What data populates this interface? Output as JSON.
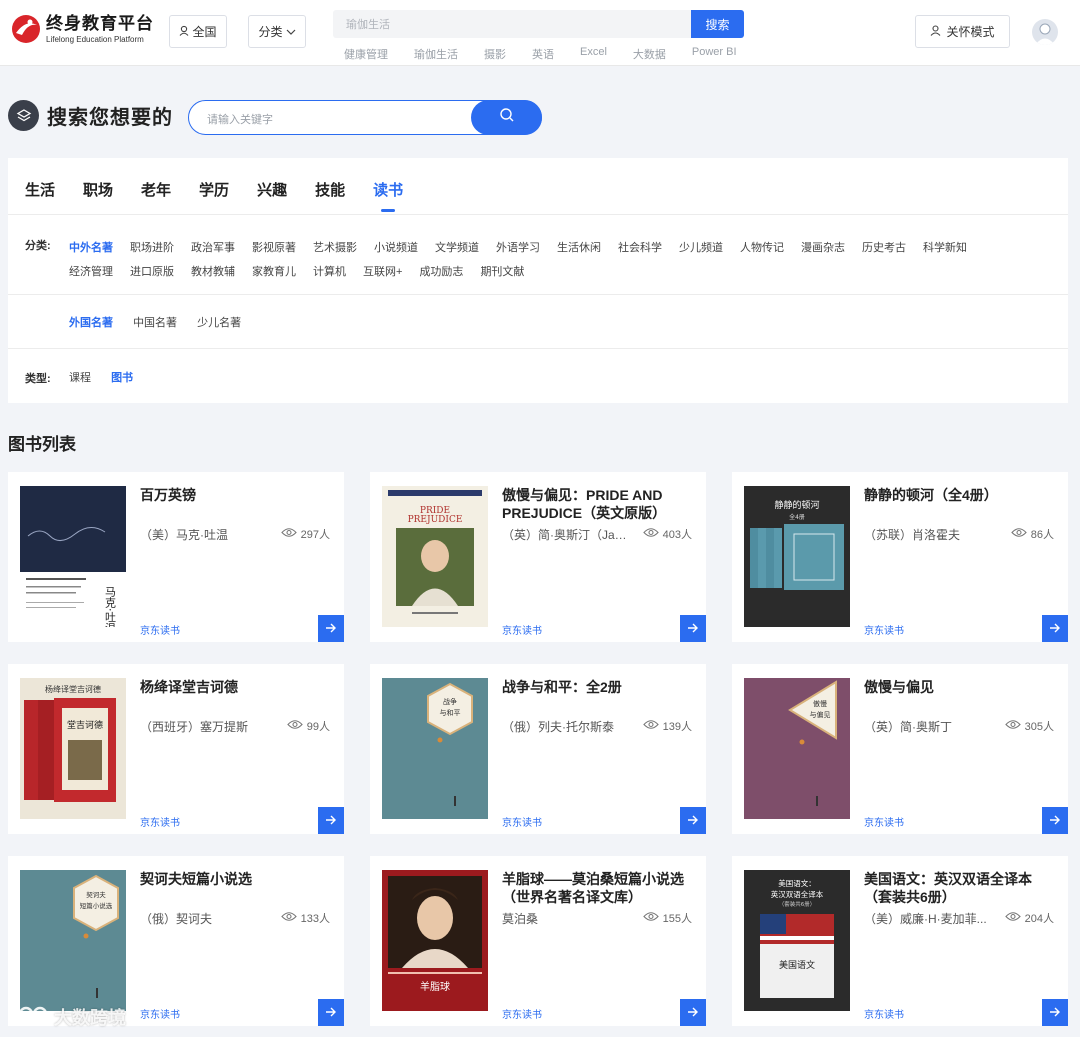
{
  "header": {
    "logo_cn": "终身教育平台",
    "logo_en": "Lifelong Education Platform",
    "region_label": "全国",
    "category_label": "分类",
    "search_placeholder": "瑜伽生活",
    "search_button": "搜索",
    "hot_keywords": [
      "健康管理",
      "瑜伽生活",
      "摄影",
      "英语",
      "Excel",
      "大数据",
      "Power BI"
    ],
    "care_mode_label": "关怀模式"
  },
  "search": {
    "title": "搜索您想要的",
    "placeholder": "请输入关键字"
  },
  "tabs": [
    "生活",
    "职场",
    "老年",
    "学历",
    "兴趣",
    "技能",
    "读书"
  ],
  "active_tab": "读书",
  "filters": {
    "category_label": "分类:",
    "categories": [
      "中外名著",
      "职场进阶",
      "政治军事",
      "影视原著",
      "艺术摄影",
      "小说频道",
      "文学频道",
      "外语学习",
      "生活休闲",
      "社会科学",
      "少儿频道",
      "人物传记",
      "漫画杂志",
      "历史考古",
      "科学新知",
      "经济管理",
      "进口原版",
      "教材教辅",
      "家教育儿",
      "计算机",
      "互联网+",
      "成功励志",
      "期刊文献"
    ],
    "subcategories": [
      "外国名著",
      "中国名著",
      "少儿名著"
    ],
    "type_label": "类型:",
    "types": [
      "课程",
      "图书"
    ]
  },
  "list_title": "图书列表",
  "books": [
    {
      "title": "百万英镑",
      "author": "（美）马克·吐温",
      "views": "297人",
      "source": "京东读书",
      "cover": "twain"
    },
    {
      "title": "傲慢与偏见：PRIDE AND PREJUDICE（英文原版）",
      "author": "（英）简·奥斯汀（Jan...",
      "views": "403人",
      "source": "京东读书",
      "cover": "pride"
    },
    {
      "title": "静静的顿河（全4册）",
      "author": "（苏联）肖洛霍夫",
      "views": "86人",
      "source": "京东读书",
      "cover": "don"
    },
    {
      "title": "杨绛译堂吉诃德",
      "author": "（西班牙）塞万提斯",
      "views": "99人",
      "source": "京东读书",
      "cover": "quixote"
    },
    {
      "title": "战争与和平：全2册",
      "author": "（俄）列夫·托尔斯泰",
      "views": "139人",
      "source": "京东读书",
      "cover": "war"
    },
    {
      "title": "傲慢与偏见",
      "author": "（英）简·奥斯丁",
      "views": "305人",
      "source": "京东读书",
      "cover": "pride2"
    },
    {
      "title": "契诃夫短篇小说选",
      "author": "（俄）契诃夫",
      "views": "133人",
      "source": "京东读书",
      "cover": "chekhov"
    },
    {
      "title": "羊脂球——莫泊桑短篇小说选（世界名著名译文库）",
      "author": "莫泊桑",
      "views": "155人",
      "source": "京东读书",
      "cover": "boule"
    },
    {
      "title": "美国语文：英汉双语全译本（套装共6册）",
      "author": "（美）威廉·H·麦加菲...",
      "views": "204人",
      "source": "京东读书",
      "cover": "reader"
    }
  ],
  "cover_text": {
    "twain_name": "马克·吐温",
    "pride_title": "PRIDE and PREJUDICE",
    "don_title": "静静的顿河",
    "don_sub": "全4册",
    "quixote_header": "杨绛译堂吉诃德",
    "war_title": "战争与和平",
    "pride2_title": "傲慢与偏见",
    "chekhov_title": "契诃夫短篇小说选",
    "boule_title": "羊脂球",
    "reader_title": "美国语文：英汉双语全译本",
    "reader_sub": "（套装共6册）"
  },
  "watermark": "大数跨境",
  "colors": {
    "accent": "#2b6cf0",
    "background": "#f2f4f8"
  }
}
